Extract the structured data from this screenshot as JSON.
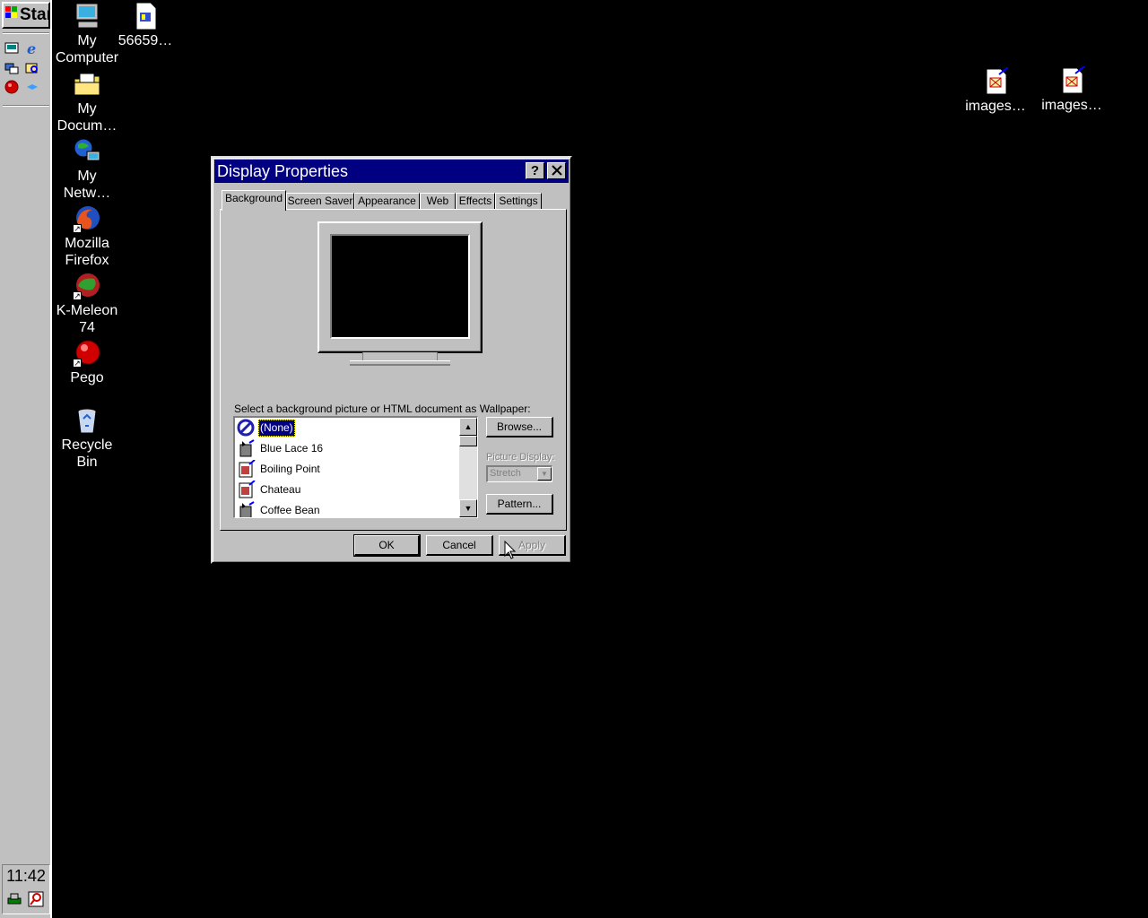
{
  "taskbar": {
    "start_label": "Start",
    "clock": "11:42"
  },
  "desktop_icons": [
    {
      "label": "My Computer"
    },
    {
      "label": "56659…"
    },
    {
      "label": "My Docum…"
    },
    {
      "label": "My Netw…"
    },
    {
      "label": "Mozilla Firefox"
    },
    {
      "label": "K-Meleon 74"
    },
    {
      "label": "Pego"
    },
    {
      "label": "Recycle Bin"
    },
    {
      "label": "images…"
    },
    {
      "label": "images…"
    }
  ],
  "dialog": {
    "title": "Display Properties",
    "help_button": "?",
    "close_button": "✕",
    "tabs": [
      "Background",
      "Screen Saver",
      "Appearance",
      "Web",
      "Effects",
      "Settings"
    ],
    "active_tab": "Background",
    "prompt": "Select a background picture or HTML document as Wallpaper:",
    "wallpapers": [
      "(None)",
      "Blue Lace 16",
      "Boiling Point",
      "Chateau",
      "Coffee Bean"
    ],
    "selected_wallpaper": "(None)",
    "browse_button": "Browse...",
    "picture_display_label": "Picture Display:",
    "picture_display_value": "Stretch",
    "pattern_button": "Pattern...",
    "ok_button": "OK",
    "cancel_button": "Cancel",
    "apply_button": "Apply"
  }
}
